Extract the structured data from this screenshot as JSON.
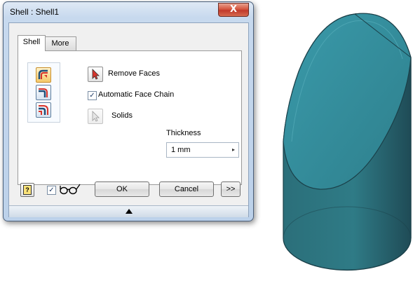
{
  "window": {
    "title": "Shell : Shell1",
    "close_label": "X"
  },
  "tabs": [
    {
      "label": "Shell",
      "active": true
    },
    {
      "label": "More",
      "active": false
    }
  ],
  "shell_tab": {
    "mode_icons": [
      "shell-inside-icon",
      "shell-outside-icon",
      "shell-both-sides-icon"
    ],
    "remove_faces_label": "Remove Faces",
    "automatic_face_chain": {
      "label": "Automatic Face Chain",
      "checked": true
    },
    "solids_label": "Solids",
    "thickness": {
      "label": "Thickness",
      "value": "1 mm"
    }
  },
  "footer": {
    "help_label": "?",
    "preview_checked": true,
    "preview_icon": "glasses-icon",
    "ok_label": "OK",
    "cancel_label": "Cancel",
    "more_label": ">>"
  },
  "colors": {
    "model_fill": "#2f7b86",
    "model_dark": "#234f5a",
    "model_light": "#3f95a3",
    "window_frame": "#c7d9ee",
    "close_button": "#c0392b"
  }
}
